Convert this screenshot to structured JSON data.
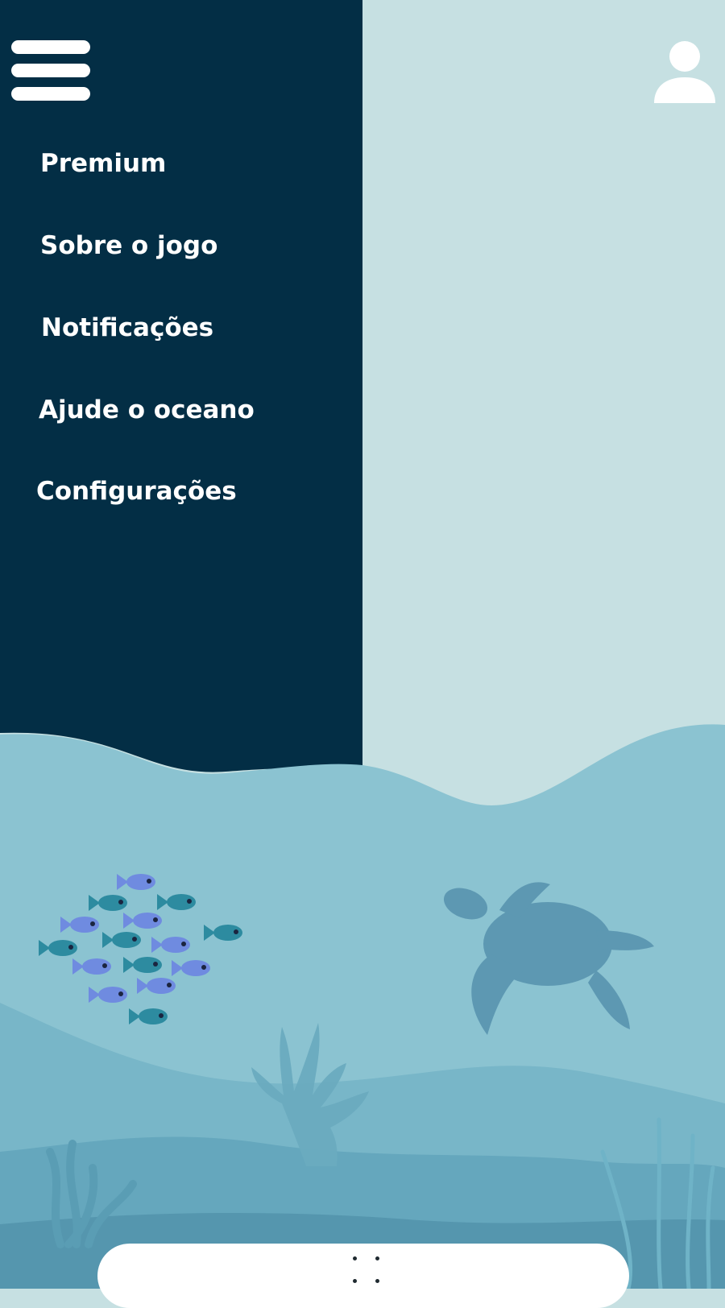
{
  "menu": {
    "items": [
      {
        "label": "Premium"
      },
      {
        "label": "Sobre o jogo"
      },
      {
        "label": "Notificações"
      },
      {
        "label": "Ajude o oceano"
      },
      {
        "label": "Configurações"
      }
    ]
  },
  "icons": {
    "menu": "hamburger-menu-icon",
    "profile": "user-profile-icon",
    "handle": "drag-handle-icon"
  },
  "colors": {
    "sidebar": "#032e45",
    "sky": "#c6e0e2",
    "water_light": "#8bc3d1",
    "water_mid": "#6fb0c4",
    "water_deep": "#5197af",
    "turtle": "#5d98b2",
    "fish_blue": "#6f8be0",
    "fish_teal": "#2d8ba0"
  }
}
